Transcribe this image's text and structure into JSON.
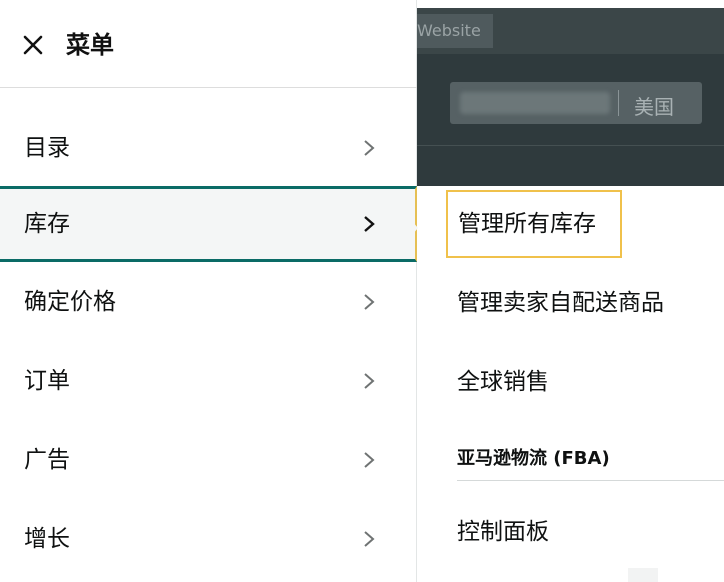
{
  "menu": {
    "title": "菜单",
    "items": [
      {
        "label": "目录"
      },
      {
        "label": "库存"
      },
      {
        "label": "确定价格"
      },
      {
        "label": "订单"
      },
      {
        "label": "广告"
      },
      {
        "label": "增长"
      }
    ],
    "active_item": "库存"
  },
  "header": {
    "site_tab": "Website",
    "region": "美国"
  },
  "submenu": {
    "items": [
      {
        "label": "管理所有库存"
      },
      {
        "label": "管理卖家自配送商品"
      },
      {
        "label": "全球销售"
      }
    ],
    "section_heading": "亚马逊物流 (FBA)",
    "section_items": [
      {
        "label": "控制面板"
      }
    ]
  },
  "colors": {
    "active_border": "#0a6b66",
    "highlight_border": "#f0c14b",
    "dark_bg": "#2f3a3d"
  }
}
